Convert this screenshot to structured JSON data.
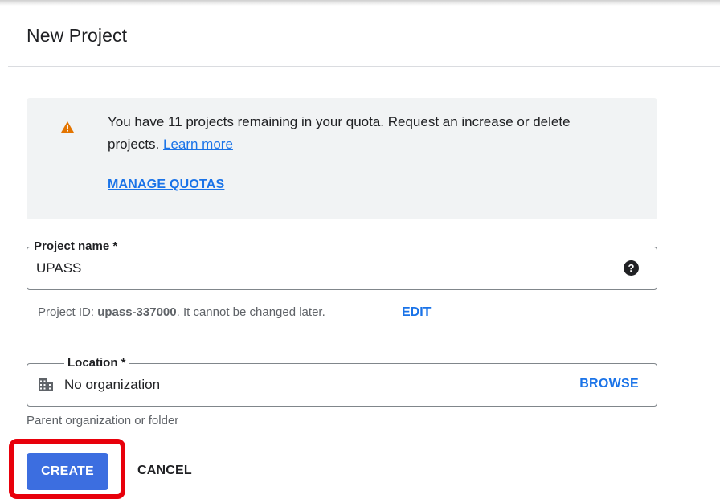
{
  "header": {
    "title": "New Project"
  },
  "quota_banner": {
    "icon": "warning-icon",
    "message": "You have 11 projects remaining in your quota. Request an increase or delete projects.",
    "learn_more_label": "Learn more",
    "manage_quotas_label": "MANAGE QUOTAS"
  },
  "project_name": {
    "label": "Project name *",
    "value": "UPASS",
    "help_icon": "help-icon"
  },
  "project_id": {
    "prefix": "Project ID:",
    "value": "upass-337000",
    "suffix": ". It cannot be changed later.",
    "edit_label": "EDIT"
  },
  "location": {
    "label": "Location *",
    "icon": "building-icon",
    "value": "No organization",
    "browse_label": "BROWSE",
    "hint": "Parent organization or folder"
  },
  "actions": {
    "create_label": "CREATE",
    "cancel_label": "CANCEL"
  },
  "colors": {
    "accent": "#1a73e8",
    "primary_button": "#3c6ee0",
    "warning": "#e37400",
    "highlight": "#e8000b",
    "banner_bg": "#f1f3f4"
  }
}
